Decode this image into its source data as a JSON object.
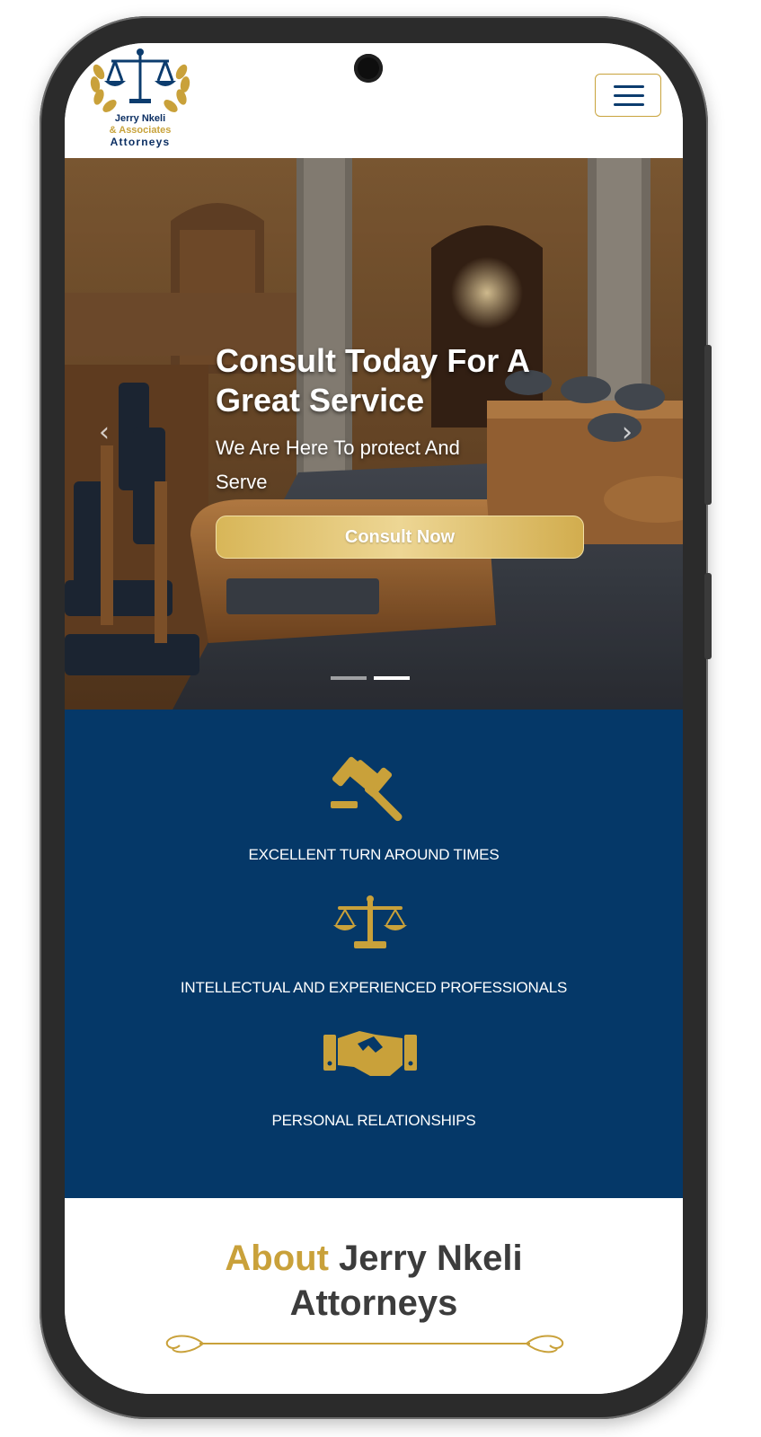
{
  "header": {
    "logo": {
      "line1": "Jerry Nkeli",
      "line2": "& Associates",
      "line3": "Attorneys"
    },
    "menu_icon": "hamburger-menu-icon"
  },
  "hero": {
    "title_line1": "Consult Today For A",
    "title_line2": "Great Service",
    "subtitle_line1": "We Are Here To protect And",
    "subtitle_line2": "Serve",
    "cta_label": "Consult Now",
    "prev_arrow": "‹",
    "next_arrow": "›",
    "slide_count": 2,
    "active_slide": 2
  },
  "features": [
    {
      "icon": "gavel-icon",
      "label": "EXCELLENT TURN AROUND TIMES"
    },
    {
      "icon": "scales-icon",
      "label": "INTELLECTUAL AND EXPERIENCED PROFESSIONALS"
    },
    {
      "icon": "handshake-icon",
      "label": "PERSONAL RELATIONSHIPS"
    }
  ],
  "about": {
    "title_accent": "About",
    "title_rest": "Jerry Nkeli",
    "title_line2": "Attorneys"
  },
  "colors": {
    "navy": "#053868",
    "gold": "#c9a13a",
    "logo_navy": "#0c2f63"
  }
}
